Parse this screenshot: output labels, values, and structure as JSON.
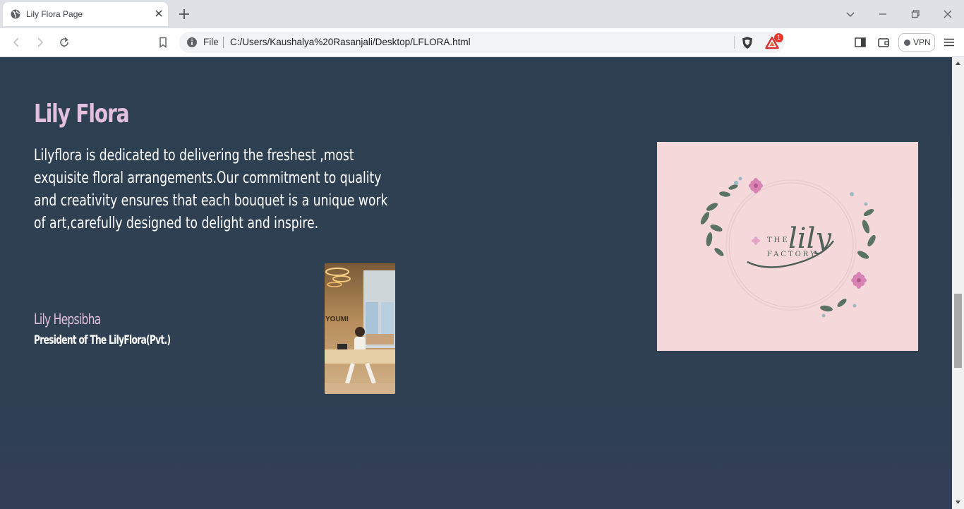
{
  "browser": {
    "tab_title": "Lily Flora Page",
    "address_scheme": "File",
    "address_url": "C:/Users/Kaushalya%20Rasanjali/Desktop/LFLORA.html",
    "rewards_badge": "1",
    "vpn_label": "VPN"
  },
  "page": {
    "brand_title": "Lily Flora",
    "intro": "Lilyflora is dedicated to delivering the freshest ,most exquisite floral arrangements.Our commitment to quality and creativity ensures that each bouquet is a unique work of art,carefully designed to delight and inspire.",
    "person_name": "Lily Hepsibha",
    "person_role": "President of The LilyFlora(Pvt.)",
    "photo_sign": "YOUMI",
    "logo_the": "THE",
    "logo_lily": "lily",
    "logo_factory": "FACTORY"
  },
  "colors": {
    "page_bg": "#2e4052",
    "accent_pink": "#e2bfdd",
    "logo_bg": "#f5d8da"
  }
}
